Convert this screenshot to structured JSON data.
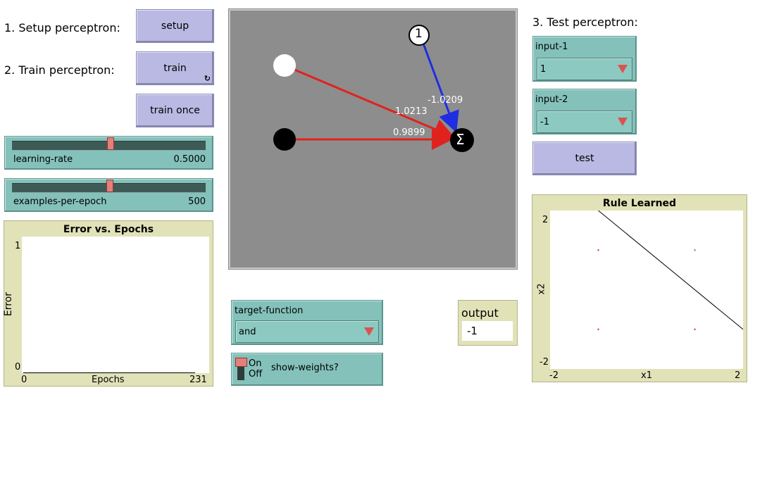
{
  "labels": {
    "setup_heading": "1. Setup perceptron:",
    "train_heading": "2. Train perceptron:",
    "test_heading": "3. Test perceptron:"
  },
  "buttons": {
    "setup": "setup",
    "train": "train",
    "train_once": "train once",
    "test": "test"
  },
  "sliders": {
    "learning_rate": {
      "name": "learning-rate",
      "value": "0.5000",
      "fraction": 0.5
    },
    "examples_per_epoch": {
      "name": "examples-per-epoch",
      "value": "500",
      "fraction": 0.5
    }
  },
  "error_plot": {
    "title": "Error vs. Epochs",
    "ylabel": "Error",
    "xlabel": "Epochs",
    "y_max": "1",
    "y_min": "0",
    "x_min": "0",
    "x_max": "231"
  },
  "network": {
    "weights": {
      "bias": "-1.0209",
      "input_1": "1.0213",
      "input_2": "0.9899"
    },
    "bias_symbol": "1",
    "sum_symbol": "Σ",
    "colors": {
      "positive_link": "#e0221f",
      "negative_link": "#1f2ee0",
      "background": "#8d8d8d"
    }
  },
  "target_function": {
    "name": "target-function",
    "value": "and"
  },
  "show_weights": {
    "on": "On",
    "off": "Off",
    "name": "show-weights?"
  },
  "output": {
    "name": "output",
    "value": "-1"
  },
  "inputs": {
    "input_1": {
      "name": "input-1",
      "value": "1"
    },
    "input_2": {
      "name": "input-2",
      "value": "-1"
    }
  },
  "rule_plot": {
    "title": "Rule Learned",
    "xlabel": "x1",
    "ylabel": "x2",
    "x_min": "-2",
    "x_max": "2",
    "y_min": "-2",
    "y_max": "2"
  },
  "chart_data": {
    "type": "scatter",
    "title": "Rule Learned",
    "xlabel": "x1",
    "ylabel": "x2",
    "xlim": [
      -2,
      2
    ],
    "ylim": [
      -2,
      2
    ],
    "series": [
      {
        "values": [
          [
            -1,
            1
          ],
          [
            -1,
            -1
          ],
          [
            1,
            -1
          ]
        ],
        "color": "#cc2222"
      },
      {
        "values": [
          [
            1,
            1
          ]
        ],
        "color": "#2a9d2a"
      }
    ],
    "line": {
      "from": [
        -1,
        2
      ],
      "to": [
        2,
        -1
      ]
    }
  }
}
